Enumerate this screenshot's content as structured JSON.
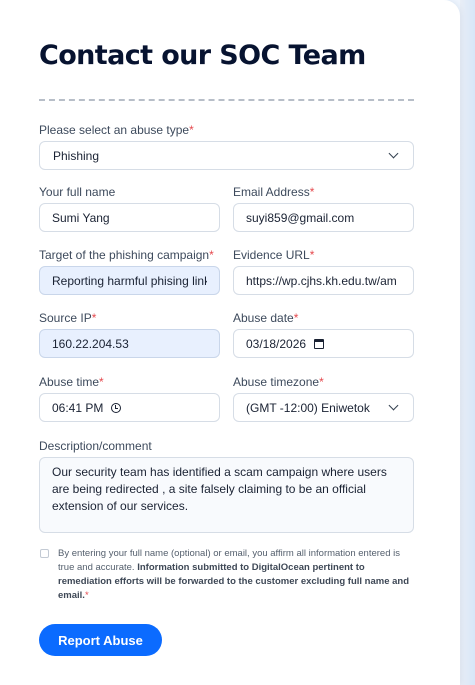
{
  "form": {
    "title": "Contact our SOC Team",
    "abuse_type": {
      "label": "Please select an abuse type",
      "required_mark": "*",
      "value": "Phishing"
    },
    "full_name": {
      "label": "Your full name",
      "value": "Sumi Yang"
    },
    "email": {
      "label": "Email Address",
      "required_mark": "*",
      "value": "suyi859@gmail.com"
    },
    "target": {
      "label": "Target of the phishing campaign",
      "required_mark": "*",
      "value": "Reporting harmful phising link"
    },
    "evidence_url": {
      "label": "Evidence URL",
      "required_mark": "*",
      "value": "https://wp.cjhs.kh.edu.tw/am"
    },
    "source_ip": {
      "label": "Source IP",
      "required_mark": "*",
      "value": "160.22.204.53"
    },
    "abuse_date": {
      "label": "Abuse date",
      "required_mark": "*",
      "value": "03/18/2026"
    },
    "abuse_time": {
      "label": "Abuse time",
      "required_mark": "*",
      "value": "06:41 PM"
    },
    "abuse_timezone": {
      "label": "Abuse timezone",
      "required_mark": "*",
      "value": "(GMT -12:00) Eniwetok"
    },
    "description": {
      "label": "Description/comment",
      "value": "Our security team has identified a scam campaign where users are being redirected , a site falsely claiming to be an official extension of our services."
    },
    "consent": {
      "text_plain": "By entering your full name (optional) or email, you affirm all information entered is true and accurate. ",
      "text_bold": "Information submitted to DigitalOcean pertinent to remediation efforts will be forwarded to the customer excluding full name and email.",
      "required_mark": "*",
      "checked": false
    },
    "submit_label": "Report Abuse"
  },
  "icons": {
    "select_arrow": "chevron-down-icon",
    "date_picker": "calendar-icon",
    "time_picker": "clock-icon"
  },
  "colors": {
    "accent": "#0b6bff",
    "required": "#e5484d",
    "title": "#071330",
    "autofill_bg": "#e8f0fe"
  }
}
